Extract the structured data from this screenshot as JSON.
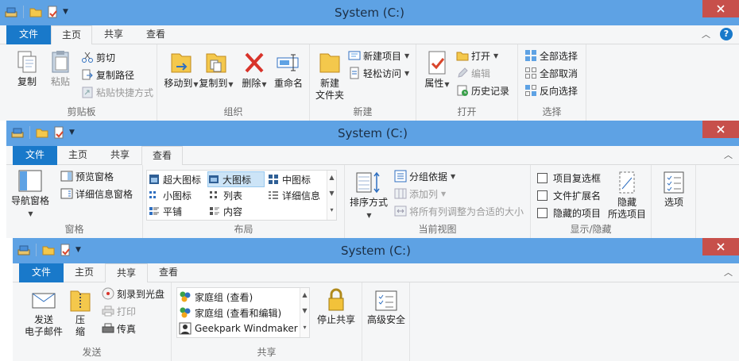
{
  "window1": {
    "title": "System (C:)",
    "tabs": {
      "file": "文件",
      "home": "主页",
      "share": "共享",
      "view": "查看"
    },
    "clipboard": {
      "copy": "复制",
      "paste": "粘贴",
      "cut": "剪切",
      "copy_path": "复制路径",
      "paste_shortcut": "粘贴快捷方式",
      "label": "剪贴板"
    },
    "organize": {
      "move_to": "移动到",
      "copy_to": "复制到",
      "delete": "删除",
      "rename": "重命名",
      "label": "组织"
    },
    "new": {
      "new_folder_1": "新建",
      "new_folder_2": "文件夹",
      "new_item": "新建项目",
      "easy_access": "轻松访问",
      "label": "新建"
    },
    "open": {
      "properties": "属性",
      "open": "打开",
      "edit": "编辑",
      "history": "历史记录",
      "label": "打开"
    },
    "select": {
      "select_all": "全部选择",
      "select_none": "全部取消",
      "invert": "反向选择",
      "label": "选择"
    }
  },
  "window2": {
    "title": "System (C:)",
    "tabs": {
      "file": "文件",
      "home": "主页",
      "share": "共享",
      "view": "查看"
    },
    "panes": {
      "nav_pane": "导航窗格",
      "preview_pane": "预览窗格",
      "details_pane": "详细信息窗格",
      "label": "窗格"
    },
    "layout": {
      "extra_large": "超大图标",
      "large": "大图标",
      "medium": "中图标",
      "small": "小图标",
      "list": "列表",
      "details": "详细信息",
      "tiles": "平铺",
      "content": "内容",
      "label": "布局"
    },
    "current_view": {
      "sort_by": "排序方式",
      "group_by": "分组依据",
      "add_columns": "添加列",
      "size_all": "将所有列调整为合适的大小",
      "label": "当前视图"
    },
    "show_hide": {
      "item_checkboxes": "项目复选框",
      "file_ext": "文件扩展名",
      "hidden_items": "隐藏的项目",
      "hide_selected_1": "隐藏",
      "hide_selected_2": "所选项目",
      "label": "显示/隐藏"
    },
    "options": {
      "options": "选项"
    }
  },
  "window3": {
    "title": "System (C:)",
    "tabs": {
      "file": "文件",
      "home": "主页",
      "share": "共享",
      "view": "查看"
    },
    "send": {
      "email_1": "发送",
      "email_2": "电子邮件",
      "zip_1": "压",
      "zip_2": "缩",
      "burn": "刻录到光盘",
      "print": "打印",
      "fax": "传真",
      "label": "发送"
    },
    "share_with": {
      "hg_view": "家庭组 (查看)",
      "hg_edit": "家庭组 (查看和编辑)",
      "user": "Geekpark Windmaker",
      "stop_sharing": "停止共享",
      "advanced": "高级安全",
      "label": "共享"
    }
  }
}
